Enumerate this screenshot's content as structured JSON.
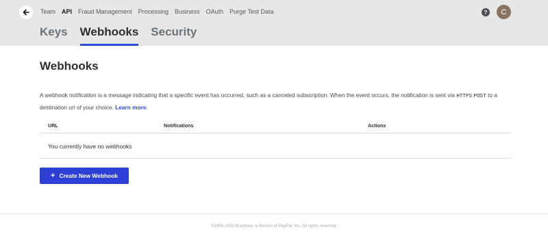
{
  "header": {
    "nav_items": [
      "Team",
      "API",
      "Fraud Management",
      "Processing",
      "Business",
      "OAuth",
      "Purge Test Data"
    ],
    "active_nav": "API",
    "help_label": "?",
    "avatar_initial": "C",
    "background_color": "#e7e7e7"
  },
  "tabs": [
    "Keys",
    "Webhooks",
    "Security"
  ],
  "active_tab": "Webhooks",
  "accent_color": "#2d4cd8",
  "main": {
    "title": "Webhooks",
    "description_start": "A webhook notification is a message indicating that a specific event has occurred, such as a canceled subscription. When the event occurs, the notification is sent via ",
    "description_code_1": "HTTPS",
    "description_code_2": "POST",
    "description_end": " to a destination url of your choice. ",
    "learn_more": "Learn more",
    "description_period": "."
  },
  "table": {
    "headers": [
      "URL",
      "Notifications",
      "Actions"
    ],
    "empty_message": "You currently have no webhooks"
  },
  "create_button": {
    "icon": "plus-icon",
    "label": "Create New Webhook"
  },
  "footer": {
    "copyright": "©2008-2020 Braintree, a division of PayPal, Inc. All rights reserved."
  }
}
